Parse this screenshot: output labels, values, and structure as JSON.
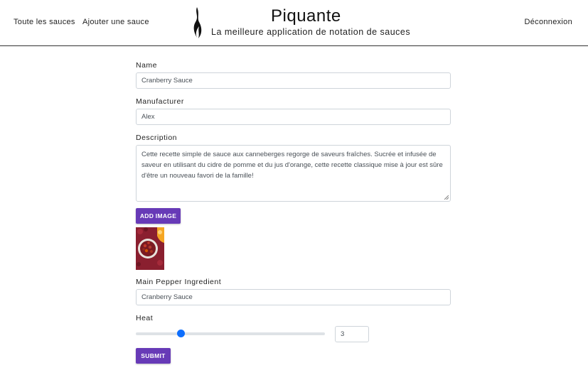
{
  "header": {
    "nav": {
      "all_sauces": "Toute les sauces",
      "add_sauce": "Ajouter une sauce",
      "logout": "Déconnexion"
    },
    "brand": {
      "title": "Piquante",
      "subtitle": "La meilleure application de notation de sauces"
    }
  },
  "form": {
    "name": {
      "label": "Name",
      "value": "Cranberry Sauce"
    },
    "manufacturer": {
      "label": "Manufacturer",
      "value": "Alex"
    },
    "description": {
      "label": "Description",
      "value": "Cette recette simple de sauce aux canneberges regorge de saveurs fraîches. Sucrée et infusée de saveur en utilisant du cidre de pomme et du jus d'orange, cette recette classique mise à jour est sûre d'être un nouveau favori de la famille!"
    },
    "add_image_label": "ADD IMAGE",
    "main_pepper": {
      "label": "Main Pepper Ingredient",
      "value": "Cranberry Sauce"
    },
    "heat": {
      "label": "Heat",
      "value": "3",
      "min": 1,
      "max": 10
    },
    "submit_label": "SUBMIT"
  },
  "colors": {
    "accent": "#673ab7",
    "slider_thumb": "#0d6efd"
  },
  "icons": {
    "logo": "flame-icon"
  }
}
